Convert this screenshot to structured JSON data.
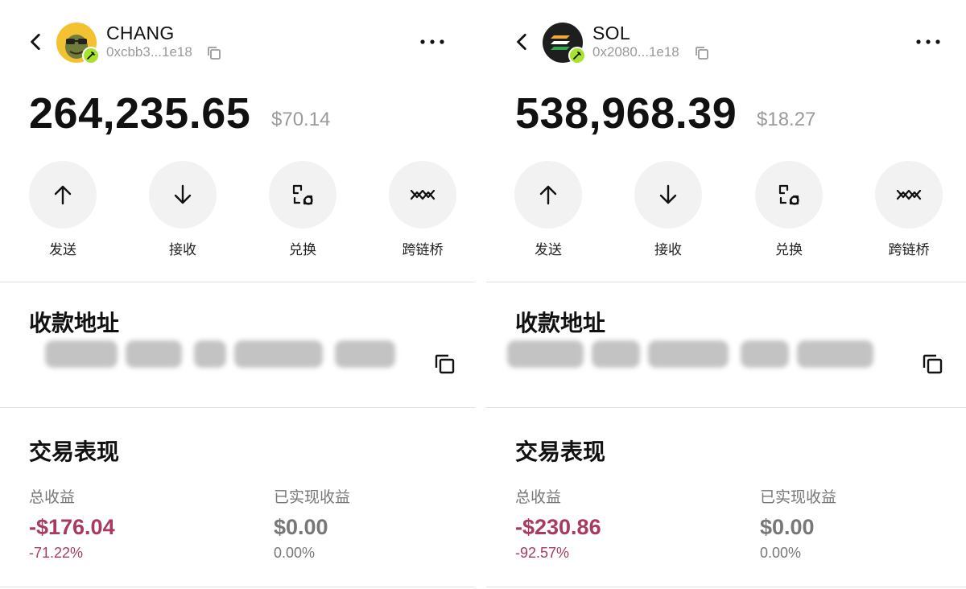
{
  "colors": {
    "negative": "#a83a5d",
    "neutral": "#777777",
    "badge": "#a6e22e"
  },
  "panels": [
    {
      "token": {
        "name": "CHANG",
        "address": "0xcbb3...1e18",
        "avatar_icon": "chang-token-avatar",
        "balance": "264,235.65",
        "fiat_value": "$70.14"
      },
      "actions": [
        {
          "label": "发送",
          "icon": "arrow-up-icon"
        },
        {
          "label": "接收",
          "icon": "arrow-down-icon"
        },
        {
          "label": "兑换",
          "icon": "swap-icon"
        },
        {
          "label": "跨链桥",
          "icon": "bridge-icon"
        }
      ],
      "receive_section": {
        "title": "收款地址"
      },
      "performance": {
        "title": "交易表现",
        "total_label": "总收益",
        "total_value": "-$176.04",
        "total_pct": "-71.22%",
        "realized_label": "已实现收益",
        "realized_value": "$0.00",
        "realized_pct": "0.00%"
      }
    },
    {
      "token": {
        "name": "SOL",
        "address": "0x2080...1e18",
        "avatar_icon": "sol-token-avatar",
        "balance": "538,968.39",
        "fiat_value": "$18.27"
      },
      "actions": [
        {
          "label": "发送",
          "icon": "arrow-up-icon"
        },
        {
          "label": "接收",
          "icon": "arrow-down-icon"
        },
        {
          "label": "兑换",
          "icon": "swap-icon"
        },
        {
          "label": "跨链桥",
          "icon": "bridge-icon"
        }
      ],
      "receive_section": {
        "title": "收款地址"
      },
      "performance": {
        "title": "交易表现",
        "total_label": "总收益",
        "total_value": "-$230.86",
        "total_pct": "-92.57%",
        "realized_label": "已实现收益",
        "realized_value": "$0.00",
        "realized_pct": "0.00%"
      }
    }
  ]
}
